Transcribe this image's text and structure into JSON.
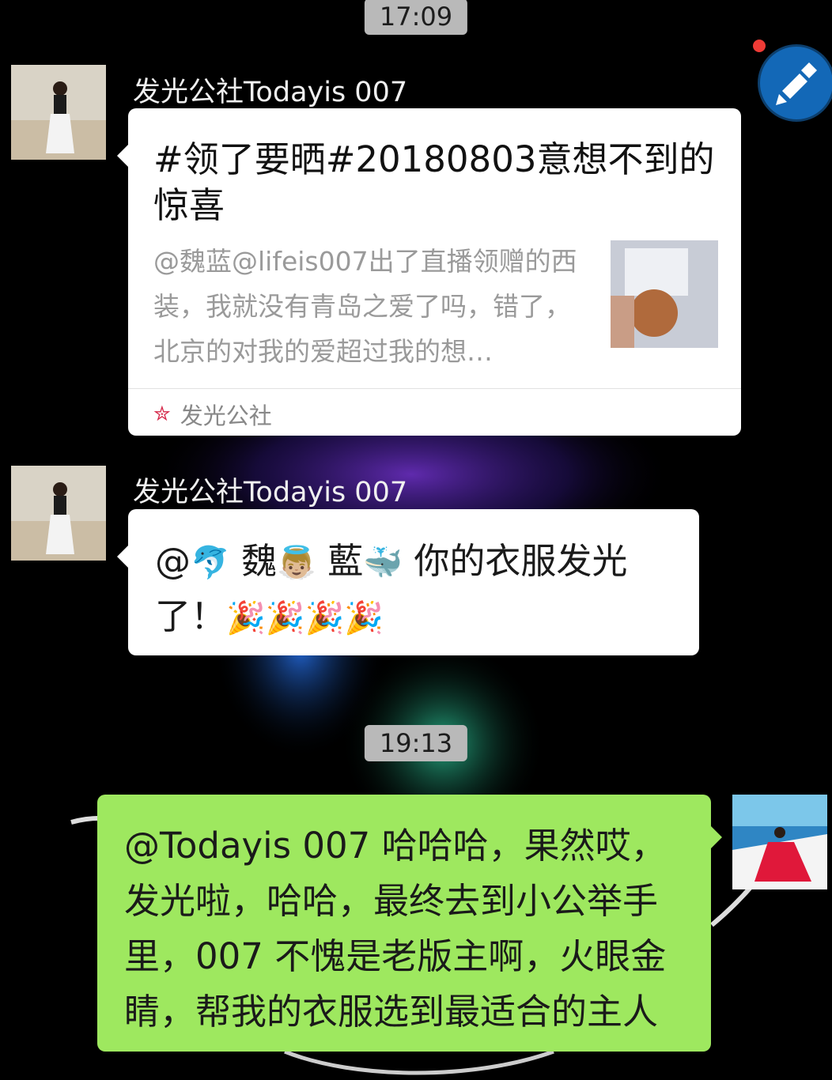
{
  "timestamps": [
    "17:09",
    "19:13"
  ],
  "messages": [
    {
      "sender": "发光公社Todayis 007",
      "card": {
        "title": "#领了要晒#20180803意想不到的惊喜",
        "description": "@魏蓝@lifeis007出了直播领赠的西装，我就没有青岛之爱了吗，错了，北京的对我的爱超过我的想…",
        "source": "发光公社",
        "source_icon": "star-icon"
      }
    },
    {
      "sender": "发光公社Todayis 007",
      "text_parts": [
        "@",
        "🐬",
        " 魏",
        "👼🏼",
        " 藍",
        "🐳",
        "  你的衣服发光了！",
        "🎉🎉🎉🎉"
      ]
    },
    {
      "text": "@Todayis 007  哈哈哈，果然哎，发光啦，哈哈，最终去到小公举手里，007 不愧是老版主啊，火眼金睛，帮我的衣服选到最适合的主人"
    }
  ],
  "floating_button_icon": "brush-icon",
  "colors": {
    "outgoing_bubble": "#9ee85f",
    "incoming_bubble": "#ffffff",
    "time_pill": "#b9b9b9"
  }
}
